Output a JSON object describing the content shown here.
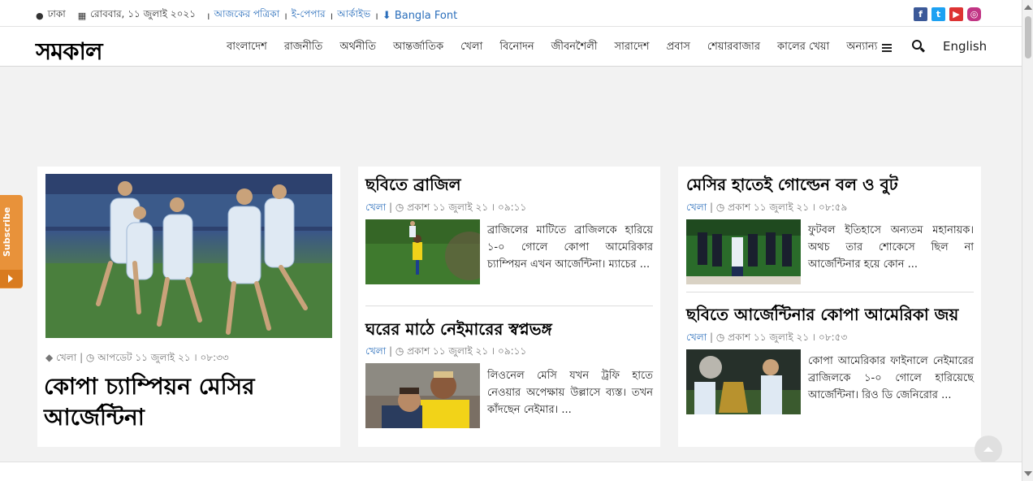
{
  "topbar": {
    "location": "ঢাকা",
    "date": "রোববার, ১১ জুলাই ২০২১",
    "links": [
      "আজকের পত্রিকা",
      "ই-পেপার",
      "আর্কাইভ"
    ],
    "bangla_font": "Bangla Font",
    "social": [
      "facebook-icon",
      "twitter-icon",
      "youtube-icon",
      "instagram-icon"
    ]
  },
  "header": {
    "logo": "সমকাল",
    "nav": [
      "বাংলাদেশ",
      "রাজনীতি",
      "অর্থনীতি",
      "আন্তর্জাতিক",
      "খেলা",
      "বিনোদন",
      "জীবনশৈলী",
      "সারাদেশ",
      "প্রবাস",
      "শেয়ারবাজার",
      "কালের খেয়া"
    ],
    "more": "অন্যান্য",
    "language": "English"
  },
  "subscribe": {
    "label": "Subscribe"
  },
  "lead": {
    "category": "খেলা",
    "updated": "আপডেট ১১ জুলাই ২১ । ০৮:৩৩",
    "title": "কোপা চ্যাম্পিয়ন মেসির আর্জেন্টিনা"
  },
  "column2": [
    {
      "title": "ছবিতে ব্রাজিল",
      "category": "খেলা",
      "published": "প্রকাশ ১১ জুলাই ২১ । ০৯:১১",
      "excerpt": "ব্রাজিলের মাটিতে ব্রাজিলকে হারিয়ে ১-০ গোলে কোপা আমেরিকার চ্যাম্পিয়ন এখন আর্জেন্টিনা। ম্যাচের ..."
    },
    {
      "title": "ঘরের মাঠে নেইমারের স্বপ্নভঙ্গ",
      "category": "খেলা",
      "published": "প্রকাশ ১১ জুলাই ২১ । ০৯:১১",
      "excerpt": "লিওনেল মেসি যখন ট্রফি হাতে নেওয়ার অপেক্ষায় উল্লাসে ব্যস্ত। তখন কাঁদছেন নেইমার। ..."
    }
  ],
  "column3": [
    {
      "title": "মেসির হাতেই গোল্ডেন বল ও বুট",
      "category": "খেলা",
      "published": "প্রকাশ ১১ জুলাই ২১ । ০৮:৫৯",
      "excerpt": "ফুটবল ইতিহাসে অন্যতম মহানায়ক। অথচ তার শোকেসে ছিল না আর্জেন্টিনার হয়ে কোন ..."
    },
    {
      "title": "ছবিতে আর্জেন্টিনার কোপা আমেরিকা জয়",
      "category": "খেলা",
      "published": "প্রকাশ ১১ জুলাই ২১ । ০৮:৫৩",
      "excerpt": "কোপা আমেরিকার ফাইনালে নেইমারের ব্রাজিলকে ১-০ গোলে হারিয়েছে আর্জেন্টিনা। রিও ডি জেনিরোর ..."
    }
  ]
}
